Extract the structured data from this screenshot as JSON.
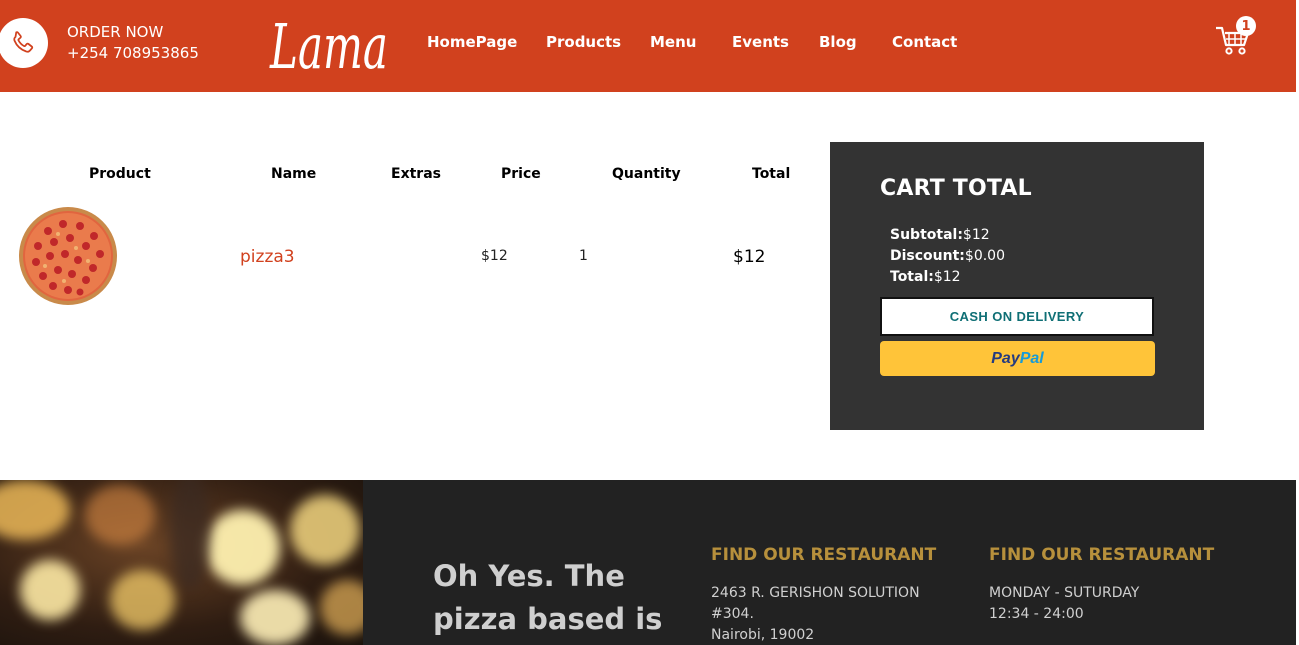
{
  "navbar": {
    "order_label": "ORDER NOW",
    "phone": "+254 708953865",
    "logo": "Lama",
    "links": [
      "HomePage",
      "Products",
      "Menu",
      "Events",
      "Blog",
      "Contact"
    ],
    "cart_count": "1",
    "icons": {
      "call": "phone-icon",
      "cart": "cart-icon"
    },
    "colors": {
      "primary": "#d1411e"
    }
  },
  "table": {
    "headers": [
      "Product",
      "Name",
      "Extras",
      "Price",
      "Quantity",
      "Total"
    ],
    "rows": [
      {
        "image": "pizza-image",
        "name": "pizza3",
        "extras": "",
        "price": "$12",
        "quantity": "1",
        "total": "$12"
      }
    ]
  },
  "cart_total": {
    "title": "CART TOTAL",
    "subtotal_label": "Subtotal:",
    "subtotal_value": "$12",
    "discount_label": "Discount:",
    "discount_value": "$0.00",
    "total_label": "Total:",
    "total_value": "$12",
    "cod_button": "CASH ON DELIVERY",
    "paypal_a": "Pay",
    "paypal_b": "Pal",
    "colors": {
      "panel": "#333333",
      "paypal": "#ffc439"
    }
  },
  "footer": {
    "slogan_line1": "Oh Yes. The",
    "slogan_line2": "pizza based is",
    "col1_title": "FIND OUR RESTAURANT",
    "col1_lines": [
      "2463 R. GERISHON SOLUTION",
      "#304.",
      "Nairobi, 19002"
    ],
    "col2_title": "FIND OUR RESTAURANT",
    "col2_lines": [
      "MONDAY - SUTURDAY",
      "12:34 - 24:00"
    ],
    "colors": {
      "background": "#222222",
      "heading": "#b7903c"
    }
  }
}
